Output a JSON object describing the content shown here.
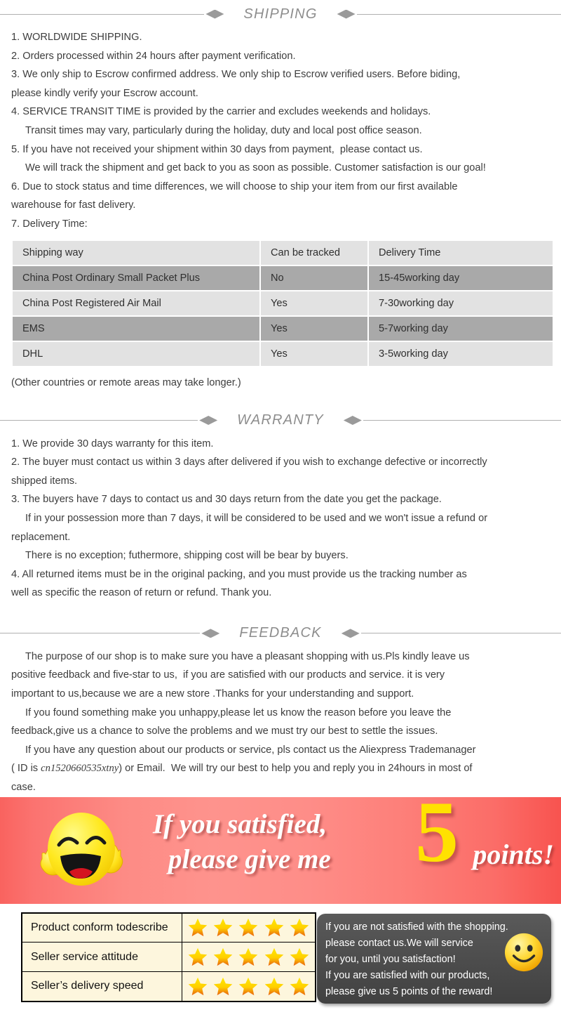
{
  "sections": {
    "shipping": {
      "title": "SHIPPING",
      "lines": [
        {
          "text": "1. WORLDWIDE SHIPPING.",
          "indent": false
        },
        {
          "text": "2. Orders processed within 24 hours after payment verification.",
          "indent": false
        },
        {
          "text": "3. We only ship to Escrow confirmed address. We only ship to Escrow verified users. Before biding,",
          "indent": false
        },
        {
          "text": "please kindly verify your Escrow account.",
          "indent": false
        },
        {
          "text": "4. SERVICE TRANSIT TIME is provided by the carrier and excludes weekends and holidays.",
          "indent": false
        },
        {
          "text": "Transit times may vary, particularly during the holiday, duty and local post office season.",
          "indent": true
        },
        {
          "text": "5. If you have not received your shipment within 30 days from payment,  please contact us.",
          "indent": false
        },
        {
          "text": "We will track the shipment and get back to you as soon as possible. Customer satisfaction is our goal!",
          "indent": true
        },
        {
          "text": "6. Due to stock status and time differences, we will choose to ship your item from our first available",
          "indent": false
        },
        {
          "text": "warehouse for fast delivery.",
          "indent": false
        },
        {
          "text": "7. Delivery Time:",
          "indent": false
        }
      ],
      "table": {
        "headers": [
          "Shipping way",
          "Can be tracked",
          "Delivery Time"
        ],
        "rows": [
          [
            "China Post Ordinary Small Packet Plus",
            "No",
            "15-45working day"
          ],
          [
            "China Post Registered Air Mail",
            "Yes",
            "7-30working day"
          ],
          [
            "EMS",
            "Yes",
            "5-7working day"
          ],
          [
            "DHL",
            "Yes",
            "3-5working day"
          ]
        ]
      },
      "note": "(Other countries or remote areas may take longer.)"
    },
    "warranty": {
      "title": "WARRANTY",
      "lines": [
        {
          "text": "1. We provide 30 days warranty for this item.",
          "indent": false
        },
        {
          "text": "2. The buyer must contact us within 3 days after delivered if you wish to exchange defective or incorrectly",
          "indent": false
        },
        {
          "text": "shipped items.",
          "indent": false
        },
        {
          "text": "3. The buyers have 7 days to contact us and 30 days return from the date you get the package.",
          "indent": false
        },
        {
          "text": "If in your possession more than 7 days, it will be considered to be used and we won't issue a refund or",
          "indent": true
        },
        {
          "text": "replacement.",
          "indent": false
        },
        {
          "text": "There is no exception; futhermore, shipping cost will be bear by buyers.",
          "indent": true
        },
        {
          "text": "4. All returned items must be in the original packing, and you must provide us the tracking number as",
          "indent": false
        },
        {
          "text": "well as specific the reason of return or refund. Thank you.",
          "indent": false
        }
      ]
    },
    "feedback": {
      "title": "FEEDBACK",
      "lines": [
        {
          "text": "The purpose of our shop is to make sure you have a pleasant shopping with us.Pls kindly leave us",
          "indent": true
        },
        {
          "text": "positive feedback and five-star to us,  if you are satisfied with our products and service. it is very",
          "indent": false
        },
        {
          "text": "important to us,because we are a new store .Thanks for your understanding and support.",
          "indent": false
        },
        {
          "text": "If you found something make you unhappy,please let us know the reason before you leave the",
          "indent": true
        },
        {
          "text": "feedback,give us a chance to solve the problems and we must try our best to settle the issues.",
          "indent": false
        },
        {
          "text": "If you have any question about our products or service, pls contact us the Aliexpress Trademanager",
          "indent": true
        }
      ],
      "contact_prefix": "( ID is ",
      "contact_id": "cn1520660535xtny",
      "contact_suffix": ") or Email.  We will try our best to help you and reply you in 24hours in most of",
      "contact_last": "case."
    }
  },
  "banner": {
    "line1": "If you satisfied,",
    "line2": "please give me",
    "big_number": "5",
    "points_label": "points!",
    "emoji_name": "laughing-face-thumbs-up",
    "bg_color_start": "#f9635f",
    "bg_color_mid": "#fe938d",
    "number_color": "#ffe200"
  },
  "ratings": {
    "rows": [
      {
        "label": "Product conform todescribe",
        "stars": 5
      },
      {
        "label": "Seller service attitude",
        "stars": 5
      },
      {
        "label": "Seller’s delivery speed",
        "stars": 5
      }
    ],
    "star_color": "#ffd400",
    "cell_bg": "#fdf6dd"
  },
  "promo": {
    "lines": [
      "If you are not satisfied with the shopping.",
      "please contact us.We will service",
      "for you, until you satisfaction!",
      "If you are satisfied with our products,",
      "please give us 5 points of the reward!"
    ],
    "smiley_name": "smiley-face",
    "bg_color": "#4d4d4d"
  }
}
